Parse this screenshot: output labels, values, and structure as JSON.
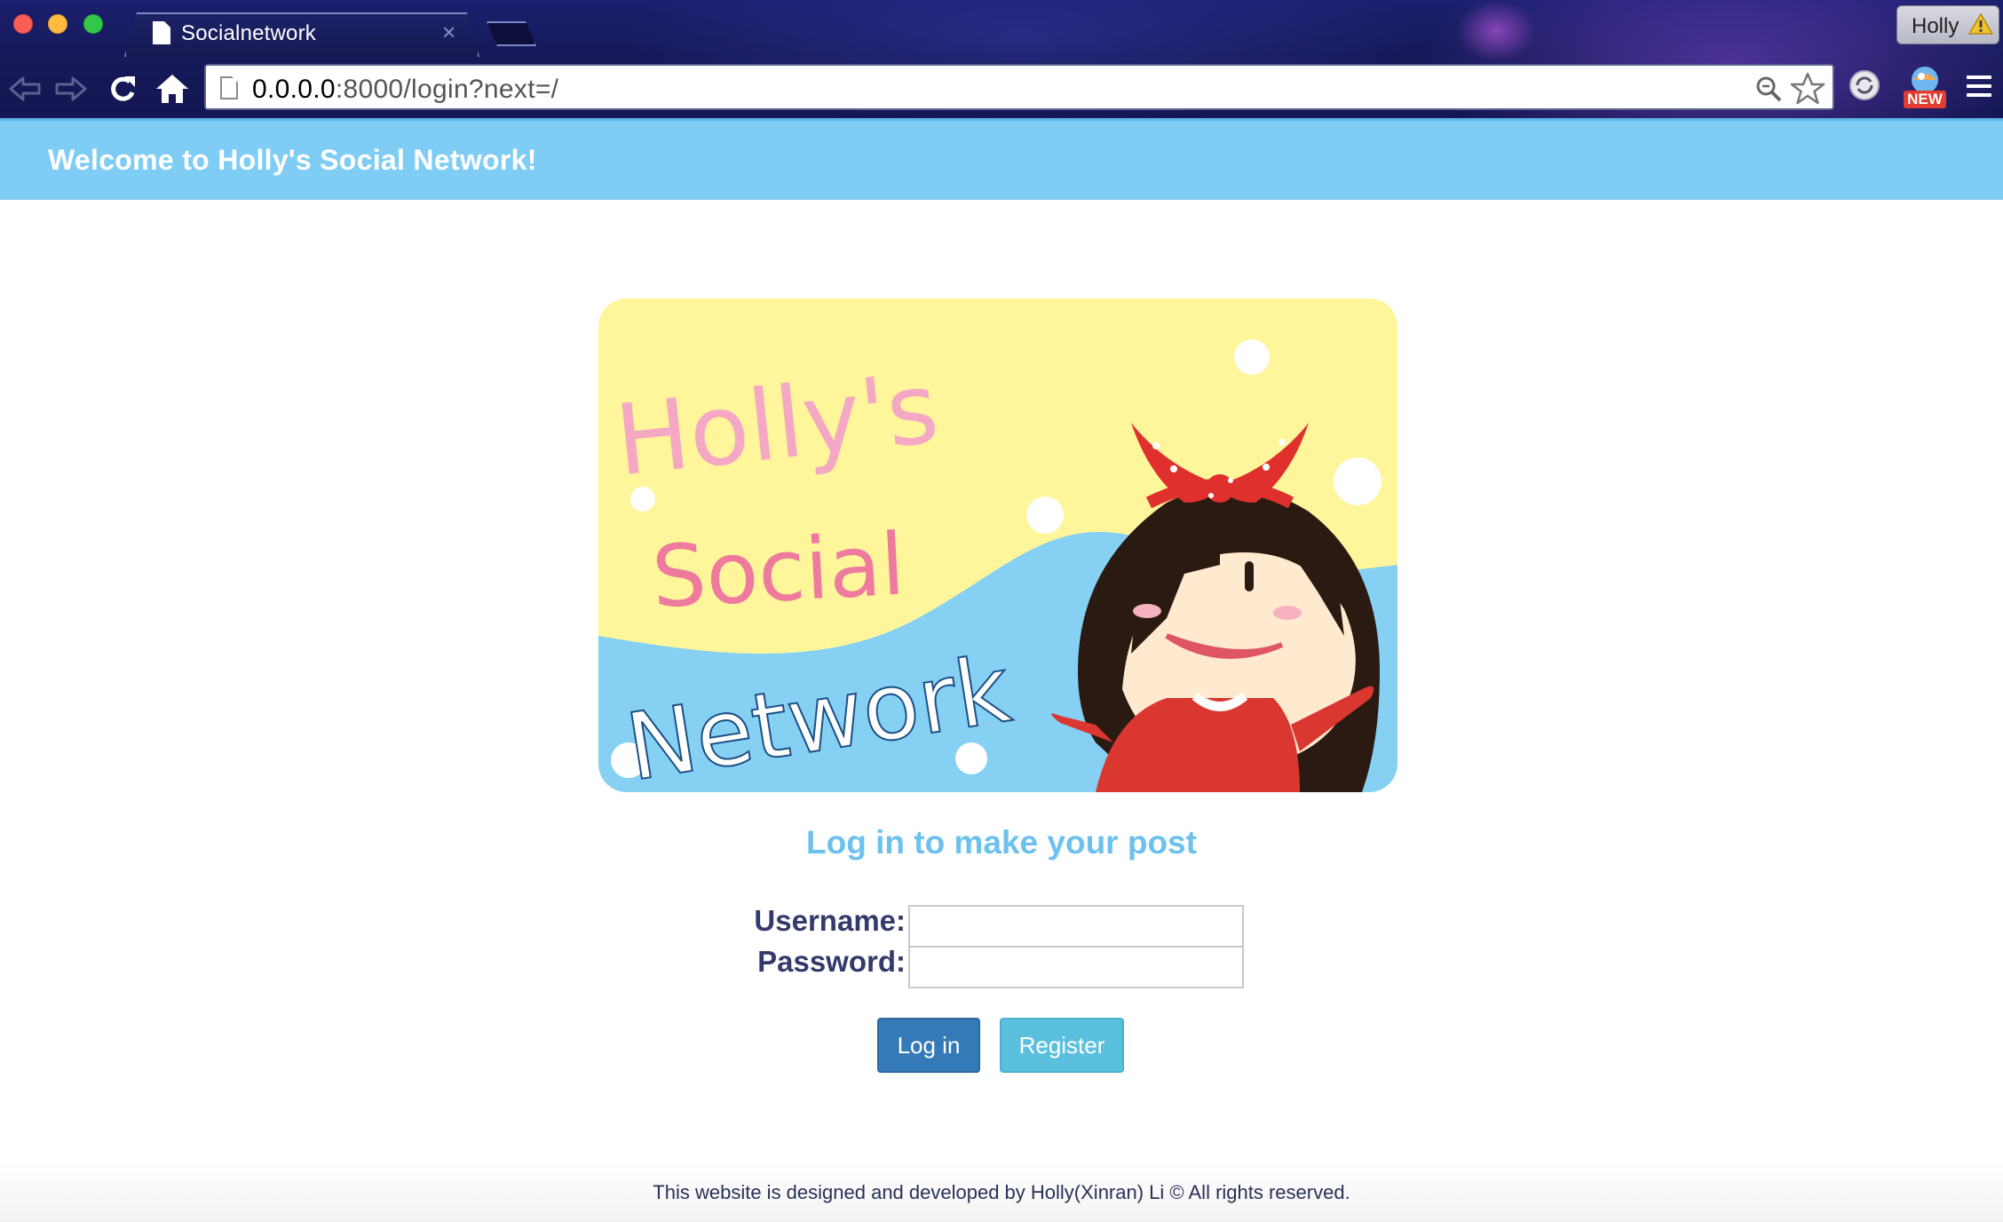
{
  "browser": {
    "tab_title": "Socialnetwork",
    "tab_close": "×",
    "profile_name": "Holly",
    "url_host": "0.0.0.0",
    "url_rest": ":8000/login?next=/",
    "extension_badge": "NEW",
    "icons": [
      "back-icon",
      "forward-icon",
      "reload-icon",
      "home-icon",
      "page-icon",
      "search-icon",
      "star-icon",
      "sync-icon",
      "extension-icon",
      "menu-icon",
      "warning-icon"
    ]
  },
  "header": {
    "title": "Welcome to Holly's Social Network!"
  },
  "hero": {
    "line1": "Holly's",
    "line2": "Social",
    "line3": "Network"
  },
  "login": {
    "heading": "Log in to make your post",
    "username_label": "Username:",
    "password_label": "Password:",
    "username_value": "",
    "password_value": "",
    "login_button": "Log in",
    "register_button": "Register"
  },
  "footer": {
    "text": "This website is designed and developed by Holly(Xinran) Li © All rights reserved."
  },
  "colors": {
    "header_bg": "#7fcdf4",
    "heading": "#6cc1ee",
    "login_button": "#337ab7",
    "register_button": "#5bc0de",
    "label": "#343a6b"
  }
}
